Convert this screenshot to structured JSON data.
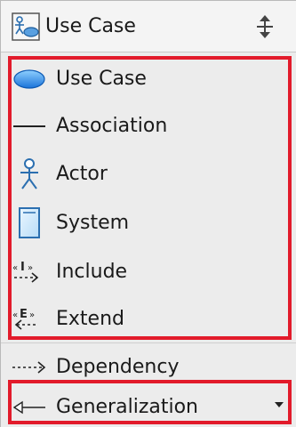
{
  "header": {
    "title": "Use Case",
    "icon": "use-case-diagram-icon",
    "toggle_icon": "expand-collapse-icon"
  },
  "items": [
    {
      "label": "Use Case",
      "icon": "use-case-ellipse-icon"
    },
    {
      "label": "Association",
      "icon": "association-line-icon"
    },
    {
      "label": "Actor",
      "icon": "actor-stick-figure-icon"
    },
    {
      "label": "System",
      "icon": "system-boundary-icon"
    },
    {
      "label": "Include",
      "icon": "include-arrow-icon"
    },
    {
      "label": "Extend",
      "icon": "extend-arrow-icon"
    },
    {
      "label": "Dependency",
      "icon": "dependency-arrow-icon"
    },
    {
      "label": "Generalization",
      "icon": "generalization-arrow-icon"
    }
  ],
  "highlight_color": "#e21b2b"
}
